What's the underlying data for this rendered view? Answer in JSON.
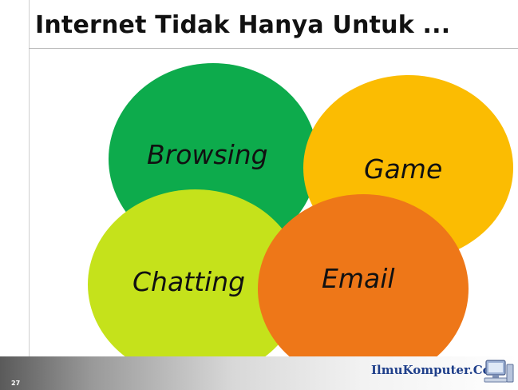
{
  "slide": {
    "title": "Internet Tidak Hanya Untuk ...",
    "number": "27"
  },
  "circles": [
    {
      "label": "Browsing",
      "color": "#0dab4c"
    },
    {
      "label": "Game",
      "color": "#fbbc02"
    },
    {
      "label": "Chatting",
      "color": "#c5e21b"
    },
    {
      "label": "Email",
      "color": "#ee7718"
    }
  ],
  "footer": {
    "brand": "IlmuKomputer.Com",
    "icon": "computer-icon"
  }
}
